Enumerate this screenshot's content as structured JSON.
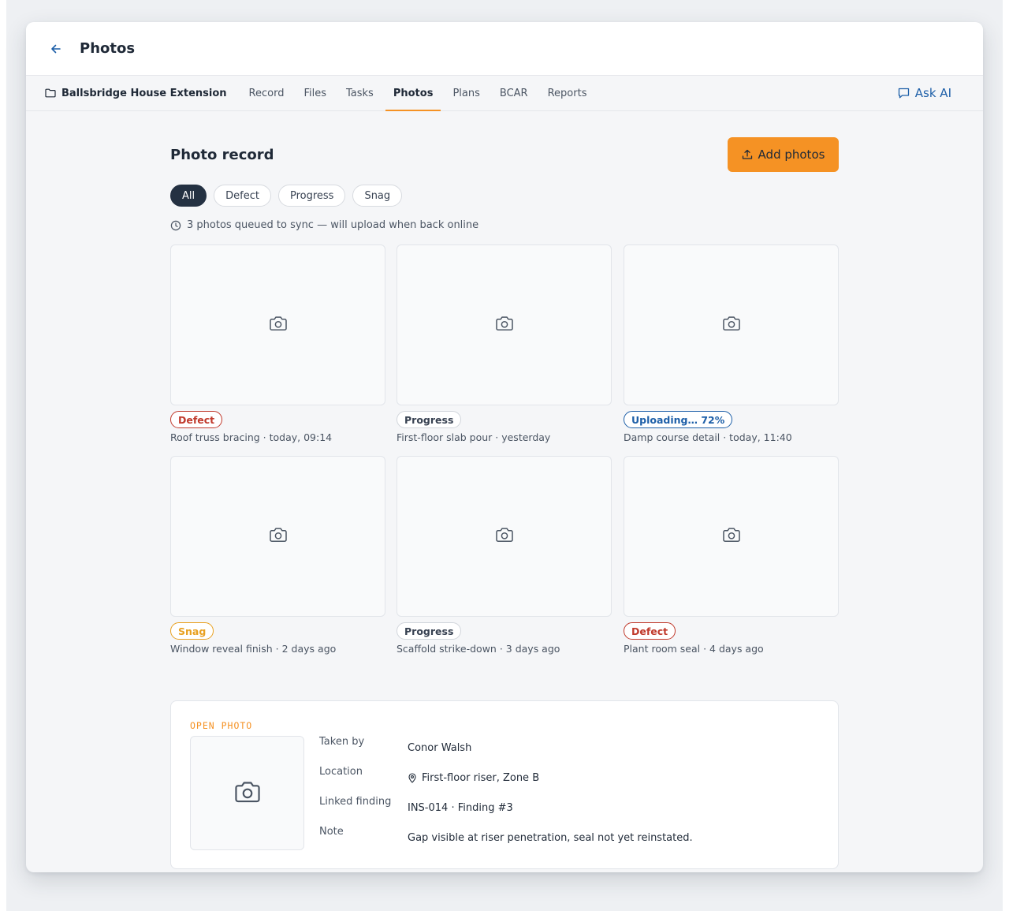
{
  "window": {
    "title": "Photos"
  },
  "nav": {
    "project": "Ballsbridge House Extension",
    "tabs": [
      {
        "label": "Record"
      },
      {
        "label": "Files"
      },
      {
        "label": "Tasks"
      },
      {
        "label": "Photos",
        "active": true
      },
      {
        "label": "Plans"
      },
      {
        "label": "BCAR"
      },
      {
        "label": "Reports"
      }
    ],
    "ask_ai": "Ask AI"
  },
  "page": {
    "title": "Photo record",
    "add_button": "Add photos",
    "filters": [
      {
        "label": "All",
        "active": true
      },
      {
        "label": "Defect"
      },
      {
        "label": "Progress"
      },
      {
        "label": "Snag"
      }
    ],
    "sync_note": "3 photos queued to sync — will upload when back online"
  },
  "photos": [
    {
      "badge": "Defect",
      "badge_type": "defect",
      "caption": "Roof truss bracing · today, 09:14"
    },
    {
      "badge": "Progress",
      "badge_type": "progress",
      "caption": "First-floor slab pour · yesterday"
    },
    {
      "badge": "Uploading… 72%",
      "badge_type": "uploading",
      "upload_progress": 72,
      "caption": "Damp course detail · today, 11:40"
    },
    {
      "badge": "Snag",
      "badge_type": "snag",
      "caption": "Window reveal finish · 2 days ago"
    },
    {
      "badge": "Progress",
      "badge_type": "progress",
      "caption": "Scaffold strike-down · 3 days ago"
    },
    {
      "badge": "Defect",
      "badge_type": "defect",
      "caption": "Plant room seal · 4 days ago"
    }
  ],
  "open_photo": {
    "label": "OPEN PHOTO",
    "fields": [
      {
        "key": "Taken by",
        "value": "Conor Walsh"
      },
      {
        "key": "Location",
        "value": "First-floor riser, Zone B",
        "icon": "pin-icon"
      },
      {
        "key": "Linked finding",
        "value": "INS-014 · Finding #3"
      },
      {
        "key": "Note",
        "value": "Gap visible at riser penetration, seal not yet reinstated."
      }
    ]
  },
  "colors": {
    "accent": "#f59224",
    "link": "#1d5fa8",
    "defect": "#c0392b",
    "snag": "#e8a020",
    "chip_active": "#243142"
  }
}
